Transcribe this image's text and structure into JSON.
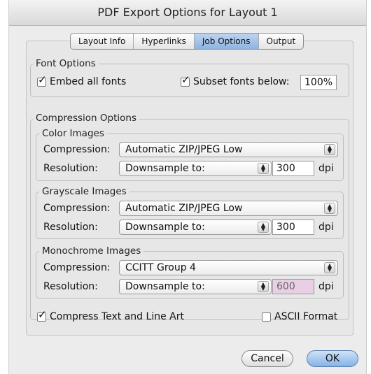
{
  "window": {
    "title": "PDF Export Options for Layout 1"
  },
  "tabs": [
    {
      "label": "Layout Info"
    },
    {
      "label": "Hyperlinks"
    },
    {
      "label": "Job Options"
    },
    {
      "label": "Output"
    }
  ],
  "font_options": {
    "title": "Font Options",
    "embed_all_fonts": {
      "label": "Embed all fonts",
      "checked": true
    },
    "subset_fonts": {
      "label": "Subset fonts below:",
      "checked": true,
      "value": "100%"
    }
  },
  "compression": {
    "title": "Compression Options",
    "compression_label": "Compression:",
    "resolution_label": "Resolution:",
    "dpi": "dpi",
    "color": {
      "title": "Color Images",
      "compression": "Automatic ZIP/JPEG Low",
      "resolution": "Downsample to:",
      "value": "300"
    },
    "grayscale": {
      "title": "Grayscale Images",
      "compression": "Automatic ZIP/JPEG Low",
      "resolution": "Downsample to:",
      "value": "300"
    },
    "monochrome": {
      "title": "Monochrome Images",
      "compression": "CCITT Group 4",
      "resolution": "Downsample to:",
      "value": "600"
    }
  },
  "compress_text": {
    "label": "Compress Text and Line Art",
    "checked": true
  },
  "ascii_format": {
    "label": "ASCII Format",
    "checked": false
  },
  "buttons": {
    "cancel": "Cancel",
    "ok": "OK"
  },
  "colors": {
    "monochrome_field_bg": "#e9cfe6",
    "active_tab": "#9ebde6"
  }
}
